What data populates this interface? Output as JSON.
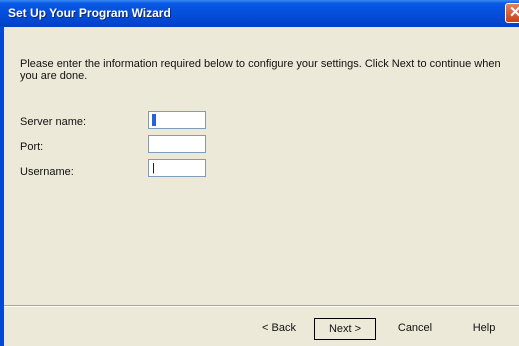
{
  "window": {
    "title": "Set Up Your Program Wizard",
    "close_glyph": "✕"
  },
  "description": "Please enter the information required below to configure your settings. Click Next to continue when you are done.",
  "fields": [
    {
      "label": "Server name:",
      "value": ""
    },
    {
      "label": "Port:",
      "value": ""
    },
    {
      "label": "Username:",
      "value": "|"
    }
  ],
  "buttons": {
    "back": "< Back",
    "next": "Next >",
    "cancel": "Cancel",
    "help": "Help"
  }
}
